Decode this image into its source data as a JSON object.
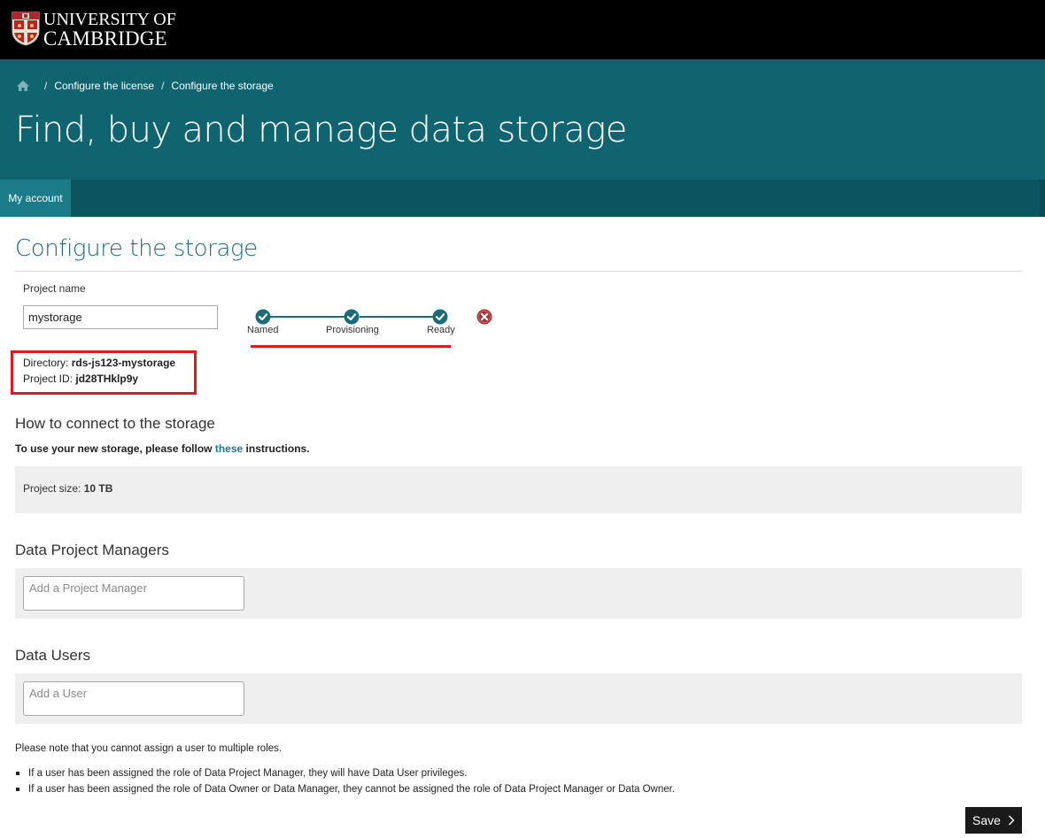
{
  "header": {
    "logo_line1": "UNIVERSITY OF",
    "logo_line2": "CAMBRIDGE"
  },
  "breadcrumb": {
    "items": [
      "Configure the license",
      "Configure the storage"
    ],
    "separator": "/"
  },
  "page_title": "Find, buy and manage data storage",
  "nav": {
    "items": [
      "My account"
    ]
  },
  "main": {
    "section_title": "Configure the storage",
    "project_name_label": "Project name",
    "project_name_value": "mystorage",
    "steps": [
      {
        "label": "Named",
        "status": "complete"
      },
      {
        "label": "Provisioning",
        "status": "complete"
      },
      {
        "label": "Ready",
        "status": "complete"
      }
    ],
    "directory_label": "Directory:",
    "directory_value": "rds-js123-mystorage",
    "project_id_label": "Project ID:",
    "project_id_value": "jd28THklp9y",
    "connect_heading": "How to connect to the storage",
    "instructions_prefix": "To use your new storage, please follow",
    "instructions_link": "these",
    "instructions_suffix": "instructions.",
    "project_size_label": "Project size:",
    "project_size_value": "10 TB",
    "managers_heading": "Data Project Managers",
    "managers_placeholder": "Add a Project Manager",
    "users_heading": "Data Users",
    "users_placeholder": "Add a User",
    "note": "Please note that you cannot assign a user to multiple roles.",
    "bullets": [
      "If a user has been assigned the role of Data Project Manager, they will have Data User privileges.",
      "If a user has been assigned the role of Data Owner or Data Manager, they cannot be assigned the role of Data Project Manager or Data Owner."
    ],
    "save_label": "Save"
  },
  "colors": {
    "banner": "#106470",
    "nav": "#0c5460",
    "nav_active": "#1b7c89",
    "accent": "#1b6c78",
    "highlight": "#e0191d",
    "cancel": "#a83232"
  },
  "icons": {
    "home": "home-icon",
    "step": "check-circle-icon",
    "cancel": "cancel-x-icon",
    "save": "chevron-right-icon",
    "crest": "cambridge-crest-icon"
  }
}
